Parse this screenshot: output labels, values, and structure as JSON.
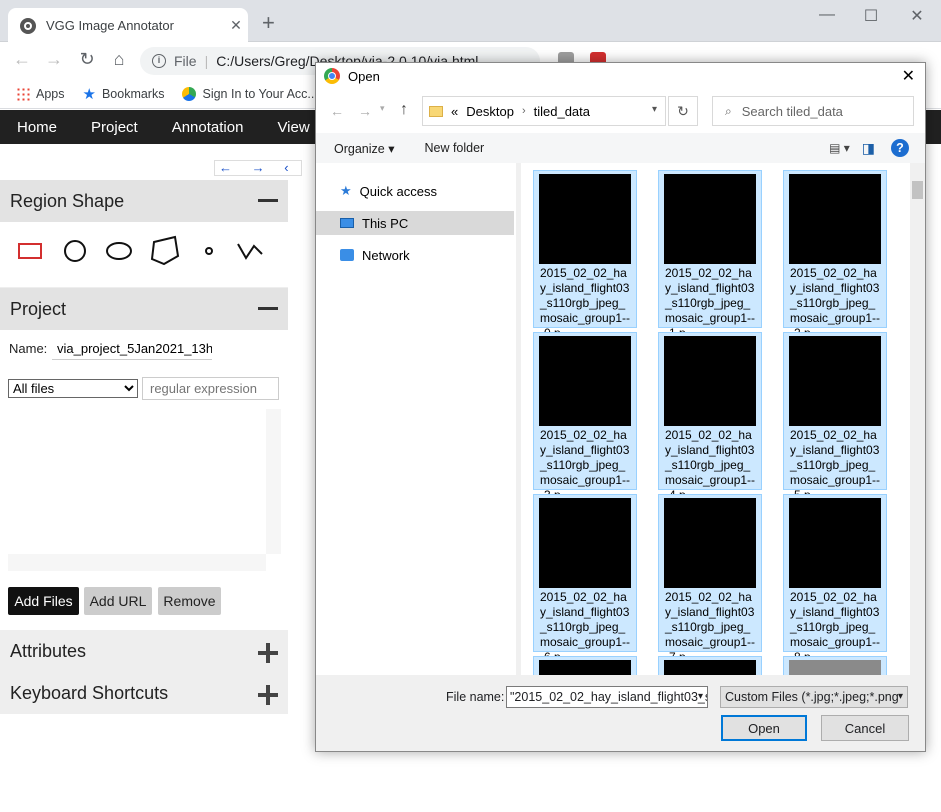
{
  "browser": {
    "tab_title": "VGG Image Annotator",
    "tab_close": "✕",
    "new_tab": "+",
    "window_min": "—",
    "window_max": "☐",
    "window_close": "✕",
    "omnibox_scheme": "File",
    "url": "C:/Users/Greg/Desktop/via-2.0.10/via.html",
    "bookmarks": [
      "Apps",
      "Bookmarks",
      "Sign In to Your Acc..."
    ]
  },
  "menubar": {
    "items": [
      "Home",
      "Project",
      "Annotation",
      "View"
    ]
  },
  "nav_arrows": "← → ‹",
  "region_shape": {
    "title": "Region Shape"
  },
  "project": {
    "title": "Project",
    "name_label": "Name:",
    "name_value": "via_project_5Jan2021_13h",
    "filter_value": "All files",
    "regex_placeholder": "regular expression"
  },
  "buttons": {
    "add_files": "Add Files",
    "add_url": "Add URL",
    "remove": "Remove"
  },
  "attributes": {
    "title": "Attributes"
  },
  "keyboard": {
    "title": "Keyboard Shortcuts"
  },
  "dialog": {
    "title": "Open",
    "close": "✕",
    "breadcrumb_prefix": "«",
    "breadcrumb": [
      "Desktop",
      "tiled_data"
    ],
    "search_placeholder": "Search tiled_data",
    "organize": "Organize ▾",
    "new_folder": "New folder",
    "help": "?",
    "nav": [
      "Quick access",
      "This PC",
      "Network"
    ],
    "files": [
      "2015_02_02_hay_island_flight03_s110rgb_jpeg_mosaic_group1---0.p...",
      "2015_02_02_hay_island_flight03_s110rgb_jpeg_mosaic_group1---1.p...",
      "2015_02_02_hay_island_flight03_s110rgb_jpeg_mosaic_group1---2.p...",
      "2015_02_02_hay_island_flight03_s110rgb_jpeg_mosaic_group1---3.p...",
      "2015_02_02_hay_island_flight03_s110rgb_jpeg_mosaic_group1---4.p...",
      "2015_02_02_hay_island_flight03_s110rgb_jpeg_mosaic_group1---5.p...",
      "2015_02_02_hay_island_flight03_s110rgb_jpeg_mosaic_group1---6.p...",
      "2015_02_02_hay_island_flight03_s110rgb_jpeg_mosaic_group1---7.p...",
      "2015_02_02_hay_island_flight03_s110rgb_jpeg_mosaic_group1---8.p..."
    ],
    "file_name_label": "File name:",
    "file_name_value": "\"2015_02_02_hay_island_flight03_s",
    "file_type": "Custom Files (*.jpg;*.jpeg;*.png",
    "open": "Open",
    "cancel": "Cancel"
  }
}
